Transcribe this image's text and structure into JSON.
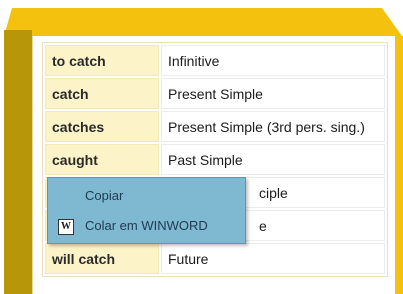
{
  "table": {
    "rows": [
      {
        "form": "to catch",
        "tense": "Infinitive"
      },
      {
        "form": "catch",
        "tense": "Present Simple"
      },
      {
        "form": "catches",
        "tense": "Present Simple (3rd pers. sing.)"
      },
      {
        "form": "caught",
        "tense": "Past Simple"
      },
      {
        "form": "",
        "tense": "ciple"
      },
      {
        "form": "",
        "tense": "e"
      },
      {
        "form": "will catch",
        "tense": "Future"
      }
    ]
  },
  "context_menu": {
    "items": [
      {
        "label": "Copiar"
      },
      {
        "label": "Colar em WINWORD",
        "icon": "word-icon"
      }
    ]
  },
  "colors": {
    "frame_gold": "#f4c20e",
    "frame_shadow": "#b8960a",
    "form_cell_bg": "#fdf3c8",
    "menu_bg": "#7fb9d1"
  }
}
